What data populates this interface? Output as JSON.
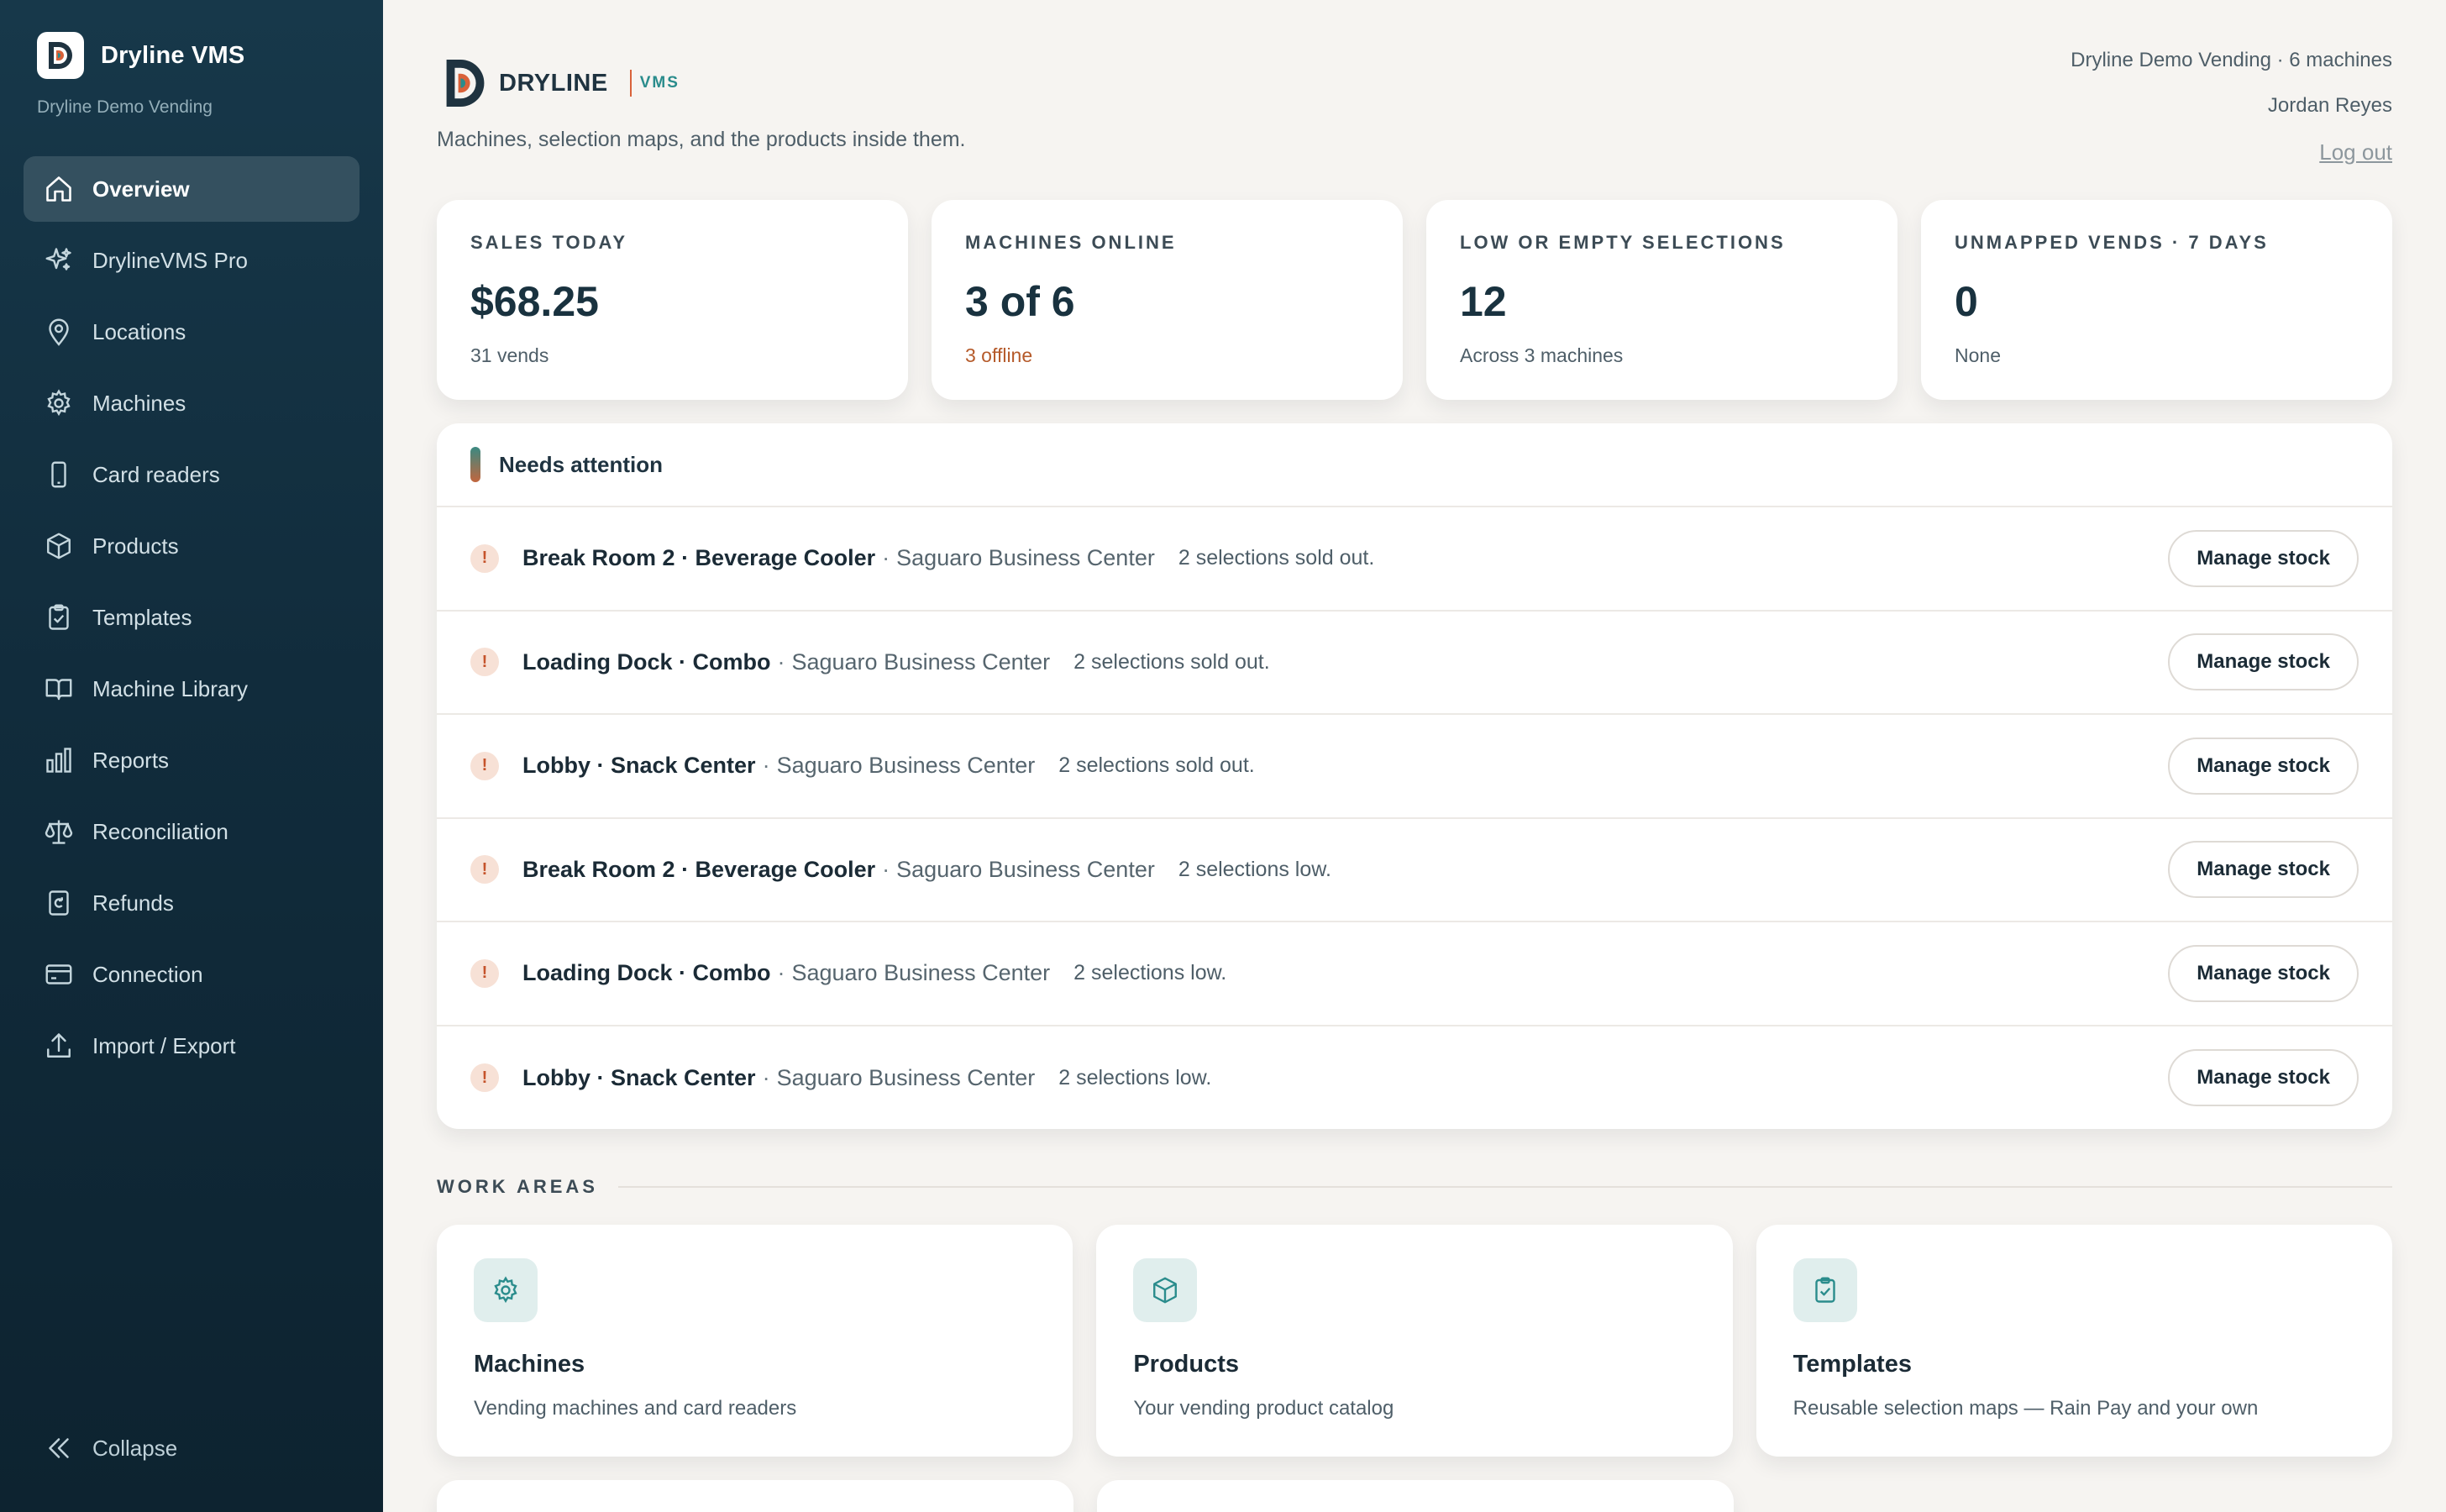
{
  "sidebar": {
    "app_name": "Dryline VMS",
    "org_name": "Dryline Demo Vending",
    "items": [
      {
        "label": "Overview",
        "icon": "home-icon",
        "active": true
      },
      {
        "label": "DrylineVMS Pro",
        "icon": "sparkle-icon"
      },
      {
        "label": "Locations",
        "icon": "map-pin-icon"
      },
      {
        "label": "Machines",
        "icon": "gear-icon"
      },
      {
        "label": "Card readers",
        "icon": "phone-icon"
      },
      {
        "label": "Products",
        "icon": "box-icon"
      },
      {
        "label": "Templates",
        "icon": "clipboard-icon"
      },
      {
        "label": "Machine Library",
        "icon": "book-icon"
      },
      {
        "label": "Reports",
        "icon": "bar-chart-icon"
      },
      {
        "label": "Reconciliation",
        "icon": "scale-icon"
      },
      {
        "label": "Refunds",
        "icon": "receipt-icon"
      },
      {
        "label": "Connection",
        "icon": "credit-card-icon"
      },
      {
        "label": "Import / Export",
        "icon": "upload-icon"
      }
    ],
    "collapse_label": "Collapse"
  },
  "header": {
    "logo_word": "DRYLINE",
    "logo_tag": "VMS",
    "tagline": "Machines, selection maps, and the products inside them.",
    "account": "Dryline Demo Vending · 6 machines",
    "user": "Jordan Reyes",
    "logout": "Log out"
  },
  "stats": [
    {
      "label": "SALES TODAY",
      "value": "$68.25",
      "sub": "31 vends"
    },
    {
      "label": "MACHINES ONLINE",
      "value": "3 of 6",
      "sub": "3 offline",
      "sub_color": "#b55a2a"
    },
    {
      "label": "LOW OR EMPTY SELECTIONS",
      "value": "12",
      "sub": "Across 3 machines"
    },
    {
      "label": "UNMAPPED VENDS · 7 DAYS",
      "value": "0",
      "sub": "None"
    }
  ],
  "attention": {
    "title": "Needs attention",
    "button_label": "Manage stock",
    "rows": [
      {
        "machine": "Break Room 2 · Beverage Cooler",
        "location": "Saguaro Business Center",
        "message": "2 selections sold out."
      },
      {
        "machine": "Loading Dock · Combo",
        "location": "Saguaro Business Center",
        "message": "2 selections sold out."
      },
      {
        "machine": "Lobby · Snack Center",
        "location": "Saguaro Business Center",
        "message": "2 selections sold out."
      },
      {
        "machine": "Break Room 2 · Beverage Cooler",
        "location": "Saguaro Business Center",
        "message": "2 selections low."
      },
      {
        "machine": "Loading Dock · Combo",
        "location": "Saguaro Business Center",
        "message": "2 selections low."
      },
      {
        "machine": "Lobby · Snack Center",
        "location": "Saguaro Business Center",
        "message": "2 selections low."
      }
    ]
  },
  "work_areas": {
    "label": "WORK AREAS",
    "cards": [
      {
        "title": "Machines",
        "desc": "Vending machines and card readers",
        "icon": "gear-icon"
      },
      {
        "title": "Products",
        "desc": "Your vending product catalog",
        "icon": "box-icon"
      },
      {
        "title": "Templates",
        "desc": "Reusable selection maps — Rain Pay and your own",
        "icon": "clipboard-icon"
      }
    ]
  },
  "colors": {
    "sidebar_bg": "#14323f",
    "accent_teal": "#2a8c8c",
    "accent_orange": "#d9623a",
    "warning_text": "#b55a2a"
  }
}
